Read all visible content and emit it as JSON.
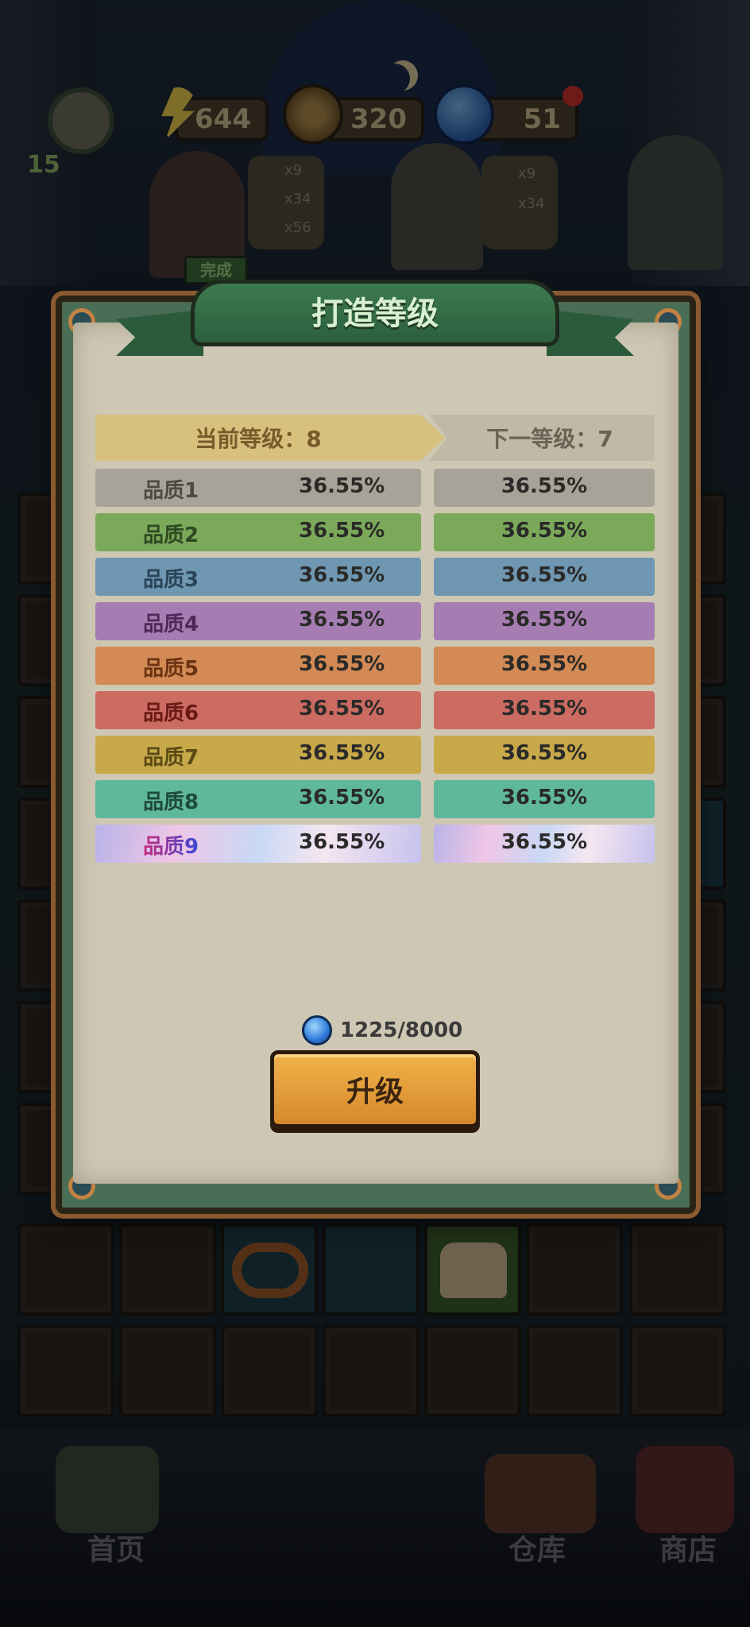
{
  "hud": {
    "player_level": "15",
    "energy": "644",
    "coins": "320",
    "gems": "51"
  },
  "customers": [
    {
      "badge": "完成",
      "rewards": [
        "x9",
        "x34",
        "x56"
      ]
    },
    {
      "rewards": [
        "x9",
        "x34"
      ]
    }
  ],
  "dialog": {
    "title": "打造等级",
    "current_level_label": "当前等级：8",
    "next_level_label": "下一等级：7",
    "rows": [
      {
        "name": "品质1",
        "current": "36.55%",
        "next": "36.55%",
        "color": "#a8a398",
        "text_color": "#4d4a44"
      },
      {
        "name": "品质2",
        "current": "36.55%",
        "next": "36.55%",
        "color": "#7aa95a",
        "text_color": "#2f4a22"
      },
      {
        "name": "品质3",
        "current": "36.55%",
        "next": "36.55%",
        "color": "#6f97b2",
        "text_color": "#2a4458"
      },
      {
        "name": "品质4",
        "current": "36.55%",
        "next": "36.55%",
        "color": "#a67db2",
        "text_color": "#4e2a5c"
      },
      {
        "name": "品质5",
        "current": "36.55%",
        "next": "36.55%",
        "color": "#d38a54",
        "text_color": "#6a3312"
      },
      {
        "name": "品质6",
        "current": "36.55%",
        "next": "36.55%",
        "color": "#cc6b62",
        "text_color": "#6a1a16"
      },
      {
        "name": "品质7",
        "current": "36.55%",
        "next": "36.55%",
        "color": "#c8a94a",
        "text_color": "#5a4a14"
      },
      {
        "name": "品质8",
        "current": "36.55%",
        "next": "36.55%",
        "color": "#5fb79c",
        "text_color": "#1e4a3c"
      },
      {
        "name": "品质9",
        "current": "36.55%",
        "next": "36.55%",
        "color": "rainbow",
        "text_color": "#7a2a8a"
      }
    ],
    "cost": "1225/8000",
    "upgrade_label": "升级"
  },
  "nav": {
    "home": "首页",
    "warehouse": "仓库",
    "shop": "商店"
  }
}
